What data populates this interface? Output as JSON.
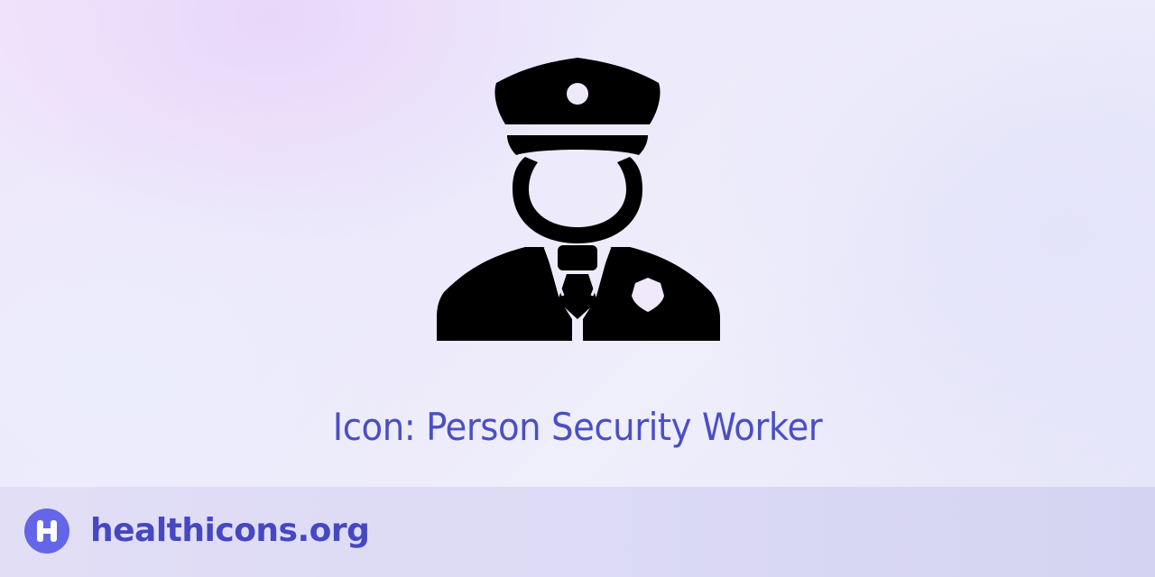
{
  "main": {
    "icon": "person-security-worker-icon",
    "caption": "Icon: Person Security Worker"
  },
  "footer": {
    "logo_icon": "healthicons-logo-icon",
    "site_name": "healthicons.org"
  },
  "colors": {
    "caption_text": "#4a4fc4",
    "site_name_text": "#4548c0",
    "logo_badge": "#6366e9",
    "icon_fill": "#000000"
  }
}
